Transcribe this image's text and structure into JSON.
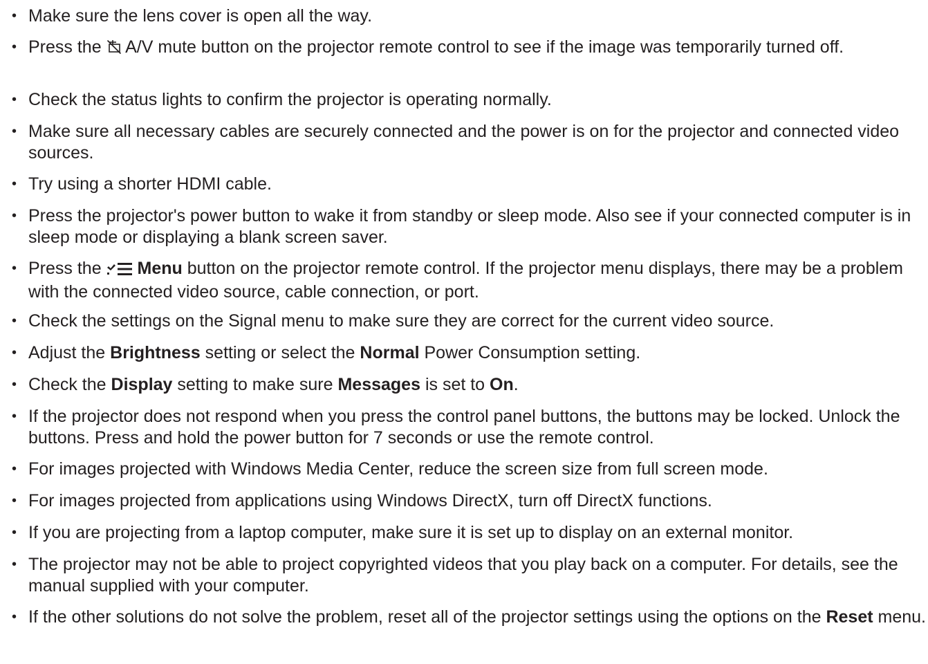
{
  "items": [
    {
      "segments": [
        {
          "t": "Make sure the lens cover is open all the way."
        }
      ]
    },
    {
      "segments": [
        {
          "t": "Press the "
        },
        {
          "icon": "av-mute-icon"
        },
        {
          "t": " A/V mute button on the projector remote control to see if the image was temporarily turned off."
        }
      ]
    },
    {
      "segments": [
        {
          "t": "Check the status lights to confirm the projector is operating normally."
        }
      ]
    },
    {
      "segments": [
        {
          "t": "Make sure all necessary cables are securely connected and the power is on for the projector and connected video sources."
        }
      ]
    },
    {
      "segments": [
        {
          "t": "Try using a shorter HDMI cable."
        }
      ]
    },
    {
      "segments": [
        {
          "t": "Press the projector's power button to wake it from standby or sleep mode. Also see if your connected computer is in sleep mode or displaying a blank screen saver."
        }
      ]
    },
    {
      "segments": [
        {
          "t": "Press the "
        },
        {
          "icon": "menu-icon"
        },
        {
          "t": " "
        },
        {
          "t": "Menu",
          "b": true
        },
        {
          "t": " button on the projector remote control. If the projector menu displays, there may be a problem with the connected video source, cable connection, or port."
        }
      ]
    },
    {
      "segments": [
        {
          "t": "Check the settings on the Signal menu to make sure they are correct for the current video source."
        }
      ]
    },
    {
      "segments": [
        {
          "t": "Adjust the "
        },
        {
          "t": "Brightness",
          "b": true
        },
        {
          "t": " setting or select the "
        },
        {
          "t": "Normal",
          "b": true
        },
        {
          "t": " Power Consumption setting."
        }
      ]
    },
    {
      "segments": [
        {
          "t": "Check the "
        },
        {
          "t": "Display",
          "b": true
        },
        {
          "t": " setting to make sure "
        },
        {
          "t": "Messages",
          "b": true
        },
        {
          "t": " is set to "
        },
        {
          "t": "On",
          "b": true
        },
        {
          "t": "."
        }
      ]
    },
    {
      "segments": [
        {
          "t": "If the projector does not respond when you press the control panel buttons, the buttons may be locked. Unlock the buttons. Press and hold the power button for 7 seconds or use the remote control."
        }
      ]
    },
    {
      "segments": [
        {
          "t": "For images projected with Windows Media Center, reduce the screen size from full screen mode."
        }
      ]
    },
    {
      "segments": [
        {
          "t": "For images projected from applications using Windows DirectX, turn off DirectX functions."
        }
      ]
    },
    {
      "segments": [
        {
          "t": "If you are projecting from a laptop computer, make sure it is set up to display on an external monitor."
        }
      ]
    },
    {
      "segments": [
        {
          "t": "The projector may not be able to project copyrighted videos that you play back on a computer. For details, see the manual supplied with your computer."
        }
      ]
    },
    {
      "segments": [
        {
          "t": "If the other solutions do not solve the problem, reset all of the projector settings using the options on the "
        },
        {
          "t": "Reset",
          "b": true
        },
        {
          "t": " menu."
        }
      ]
    }
  ]
}
